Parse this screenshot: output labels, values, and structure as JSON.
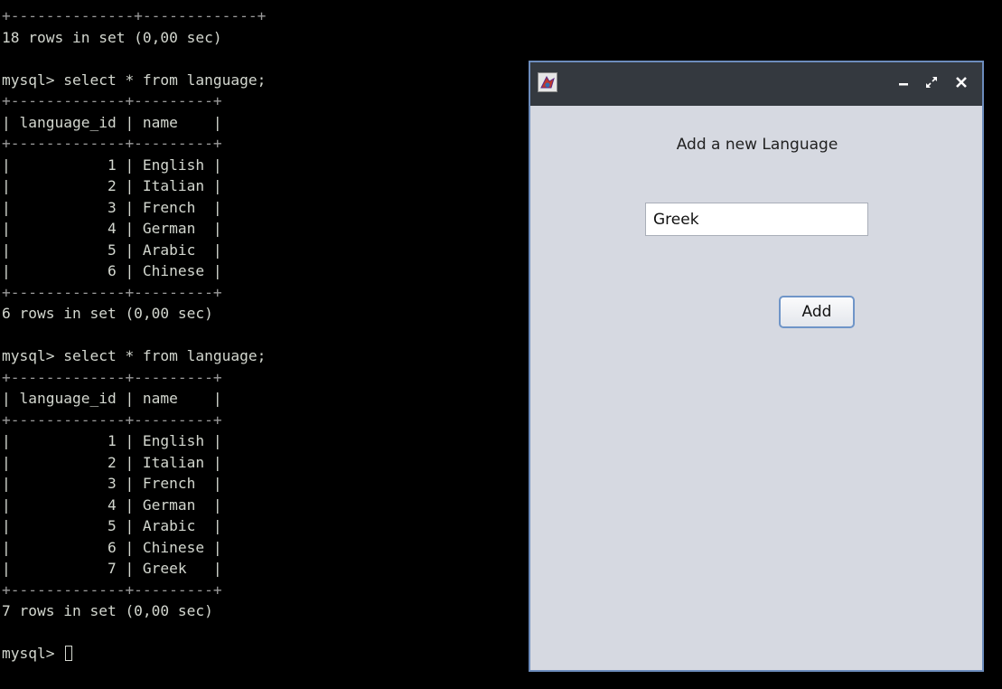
{
  "terminal": {
    "lines": [
      "+--------------+-------------+",
      "18 rows in set (0,00 sec)",
      "",
      "mysql> select * from language;",
      "+-------------+---------+",
      "| language_id | name    |",
      "+-------------+---------+",
      "|           1 | English |",
      "|           2 | Italian |",
      "|           3 | French  |",
      "|           4 | German  |",
      "|           5 | Arabic  |",
      "|           6 | Chinese |",
      "+-------------+---------+",
      "6 rows in set (0,00 sec)",
      "",
      "mysql> select * from language;",
      "+-------------+---------+",
      "| language_id | name    |",
      "+-------------+---------+",
      "|           1 | English |",
      "|           2 | Italian |",
      "|           3 | French  |",
      "|           4 | German  |",
      "|           5 | Arabic  |",
      "|           6 | Chinese |",
      "|           7 | Greek   |",
      "+-------------+---------+",
      "7 rows in set (0,00 sec)",
      "",
      "mysql> "
    ],
    "colors": {
      "background": "#000000",
      "text": "#d3d7cf",
      "border_text": "#9a9a9a"
    }
  },
  "dialog": {
    "icons": {
      "app": "java-app-icon",
      "minimize": "minimize-icon",
      "maximize": "maximize-icon",
      "close": "close-icon"
    },
    "heading": "Add a new Language",
    "input_value": "Greek",
    "add_label": "Add",
    "colors": {
      "titlebar": "#34393f",
      "border": "#6c8cbc",
      "content_bg": "#d6d9e1",
      "button_border": "#6f95c8"
    }
  }
}
